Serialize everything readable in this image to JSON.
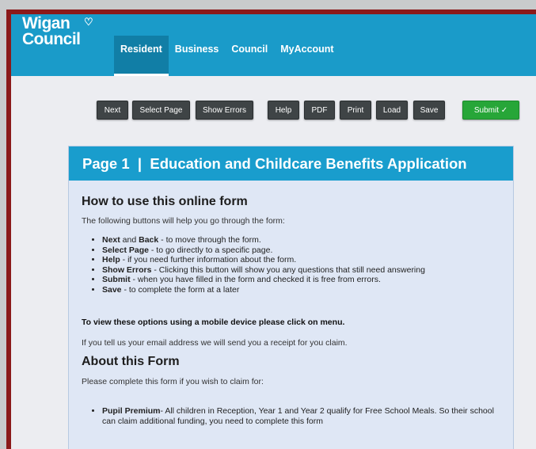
{
  "header": {
    "logo_line1": "Wigan",
    "logo_line2": "Council",
    "nav": [
      "Resident",
      "Business",
      "Council",
      "MyAccount"
    ]
  },
  "toolbar": {
    "next": "Next",
    "select_page": "Select Page",
    "show_errors": "Show Errors",
    "help": "Help",
    "pdf": "PDF",
    "print": "Print",
    "load": "Load",
    "save": "Save",
    "submit": "Submit ✓"
  },
  "form": {
    "title": "Page 1  |  Education and Childcare Benefits Application",
    "how_heading": "How to use this online form",
    "how_intro": "The following buttons will help you go through the form:",
    "how_items": [
      {
        "term": "Next",
        "mid": " and ",
        "term2": "Back",
        "desc": " - to move through the form."
      },
      {
        "term": "Select Page",
        "desc": " - to go directly to a specific page."
      },
      {
        "term": "Help",
        "desc": " - if you need further information about the form."
      },
      {
        "term": "Show Errors",
        "desc": " - Clicking this button will show you any questions that still need answering"
      },
      {
        "term": "Submit",
        "desc": " - when you have filled in the form and checked it is free from errors."
      },
      {
        "term": "Save",
        "desc": " - to complete the form at a later"
      }
    ],
    "mobile_note": "To view these options using a mobile device please click on menu.",
    "email_note": "If you tell us your email address we will send you a receipt for you claim.",
    "about_heading": "About this Form",
    "about_intro": "Please complete this form if you wish to claim for:",
    "about_items": [
      {
        "term": "Pupil Premium",
        "desc": "- All children in Reception, Year 1 and Year 2 qualify for Free School Meals. So their school can claim additional funding, you need to complete this form"
      }
    ]
  },
  "colors": {
    "header": "#1a9bc9",
    "frame": "#8b1a1a",
    "toolbar_button": "#3f4446",
    "submit_button": "#27a638",
    "form_title": "#199dcd",
    "form_body": "#dfe7f5"
  }
}
